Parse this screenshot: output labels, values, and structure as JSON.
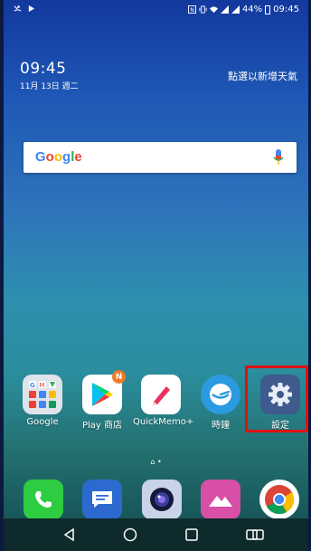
{
  "status_bar": {
    "battery": "44%",
    "time": "09:45"
  },
  "clock_widget": {
    "time": "09:45",
    "date": "11月 13日 週二",
    "weather_hint": "點選以新增天氣"
  },
  "search": {
    "logo": "Google"
  },
  "apps": [
    {
      "label": "Google",
      "icon": "google-folder-icon"
    },
    {
      "label": "Play 商店",
      "icon": "play-store-icon",
      "badge": "N"
    },
    {
      "label": "QuickMemo+",
      "icon": "quickmemo-icon"
    },
    {
      "label": "時鐘",
      "icon": "clock-icon"
    },
    {
      "label": "設定",
      "icon": "settings-gear-icon"
    }
  ],
  "dock": [
    "phone-icon",
    "messages-icon",
    "camera-icon",
    "gallery-icon",
    "chrome-icon"
  ],
  "colors": {
    "highlight": "#e01010",
    "badge": "#f07a2a"
  }
}
